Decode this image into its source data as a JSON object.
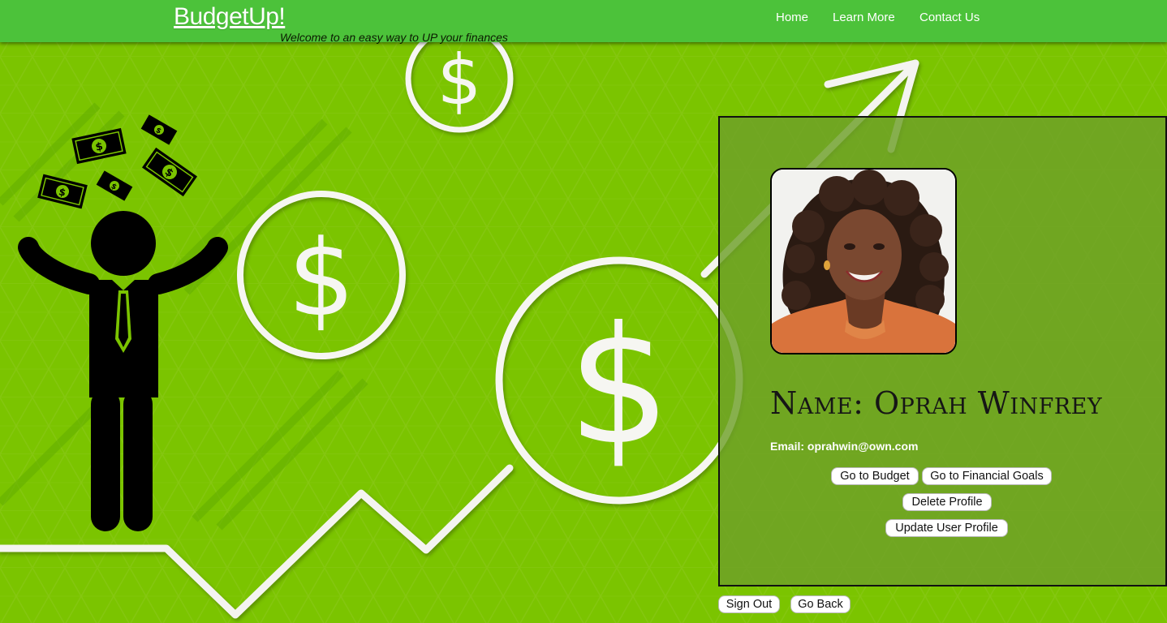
{
  "app": {
    "brand": "BudgetUp!",
    "tagline": "Welcome to an easy way to UP your finances"
  },
  "nav": {
    "links": [
      {
        "label": "Home"
      },
      {
        "label": "Learn More"
      },
      {
        "label": "Contact Us"
      }
    ]
  },
  "profile": {
    "name": "Name: Oprah Winfrey",
    "email": "Email: oprahwin@own.com",
    "buttons": {
      "budget": "Go to Budget",
      "goals": "Go to Financial Goals",
      "delete": "Delete Profile",
      "update": "Update User Profile"
    }
  },
  "footer_buttons": {
    "sign_out": "Sign Out",
    "go_back": "Go Back"
  },
  "colors": {
    "background": "#7bc400",
    "navbar": "#4cc23a",
    "card": "#6ea028"
  },
  "icons": [
    "dollar-coin-icon",
    "money-bill-icon",
    "businessman-icon",
    "growth-arrow-icon",
    "profile-photo"
  ]
}
